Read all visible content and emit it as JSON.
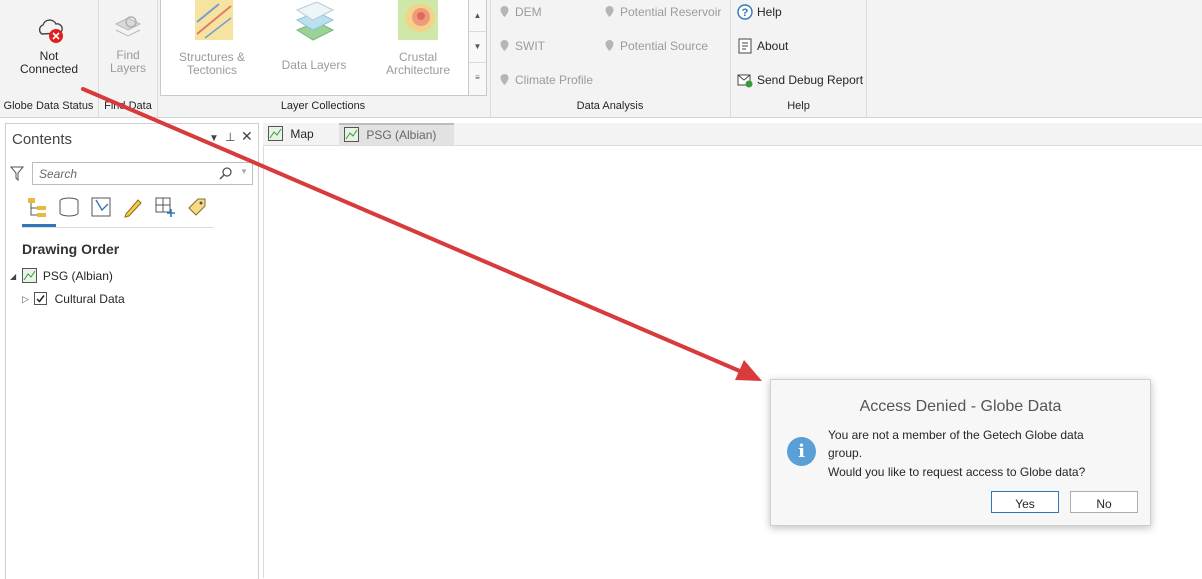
{
  "ribbon": {
    "globe_status": {
      "label_line1": "Not",
      "label_line2": "Connected",
      "group_label": "Globe Data Status"
    },
    "find_data": {
      "label_line1": "Find",
      "label_line2": "Layers",
      "group_label": "Find Data"
    },
    "layer_collections": {
      "items": [
        {
          "line1": "Structures &",
          "line2": "Tectonics"
        },
        {
          "line1": "Data Layers",
          "line2": ""
        },
        {
          "line1": "Crustal",
          "line2": "Architecture"
        }
      ],
      "group_label": "Layer Collections"
    },
    "data_analysis": {
      "items": [
        "DEM",
        "SWIT",
        "Climate Profile",
        "Potential Reservoir",
        "Potential Source"
      ],
      "group_label": "Data Analysis"
    },
    "help": {
      "items": [
        "Help",
        "About",
        "Send Debug Report"
      ],
      "group_label": "Help"
    }
  },
  "contents": {
    "title": "Contents",
    "search_placeholder": "Search",
    "drawing_order": "Drawing Order",
    "tree": {
      "map_name": "PSG (Albian)",
      "layer_name": "Cultural Data",
      "layer_checked": true
    }
  },
  "tabs": [
    {
      "label": "Map",
      "active": false
    },
    {
      "label": "PSG (Albian)",
      "active": true
    }
  ],
  "dialog": {
    "title": "Access Denied - Globe Data",
    "message_line1": "You are not a member of the Getech Globe data",
    "message_line2": "group.",
    "message_line3": "Would you like to request access to Globe data?",
    "yes_label": "Yes",
    "no_label": "No"
  },
  "colors": {
    "accent": "#2f77b8",
    "error_red": "#e02020",
    "annotation_arrow": "#d93a3a",
    "info_blue": "#5aa0d6"
  }
}
